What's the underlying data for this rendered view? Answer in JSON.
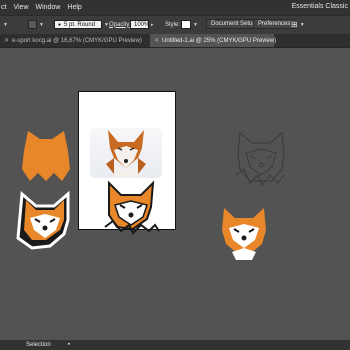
{
  "menubar": {
    "items": [
      "ct",
      "View",
      "Window",
      "Help"
    ],
    "workspace": "Essentials Classic"
  },
  "controlbar": {
    "stroke_profile": "5 pt. Round",
    "opacity_label": "Opacity:",
    "opacity_value": "100%",
    "style_label": "Style:",
    "document_setup": "Document Setup",
    "preferences": "Preferences"
  },
  "tabs": [
    {
      "label": "e-sport kocg.ai @ 16,67% (CMYK/GPU Preview)",
      "active": false
    },
    {
      "label": "Untitled-1.ai @ 25% (CMYK/GPU Preview)",
      "active": true
    }
  ],
  "status": {
    "tool": "Selection"
  },
  "colors": {
    "fox_orange": "#e8862a",
    "fox_dark": "#1a1a1a",
    "canvas": "#535353",
    "artboard": "#ffffff"
  },
  "icons": [
    "brush-icon",
    "close-icon",
    "arrange-icon",
    "chevron-down-icon"
  ]
}
